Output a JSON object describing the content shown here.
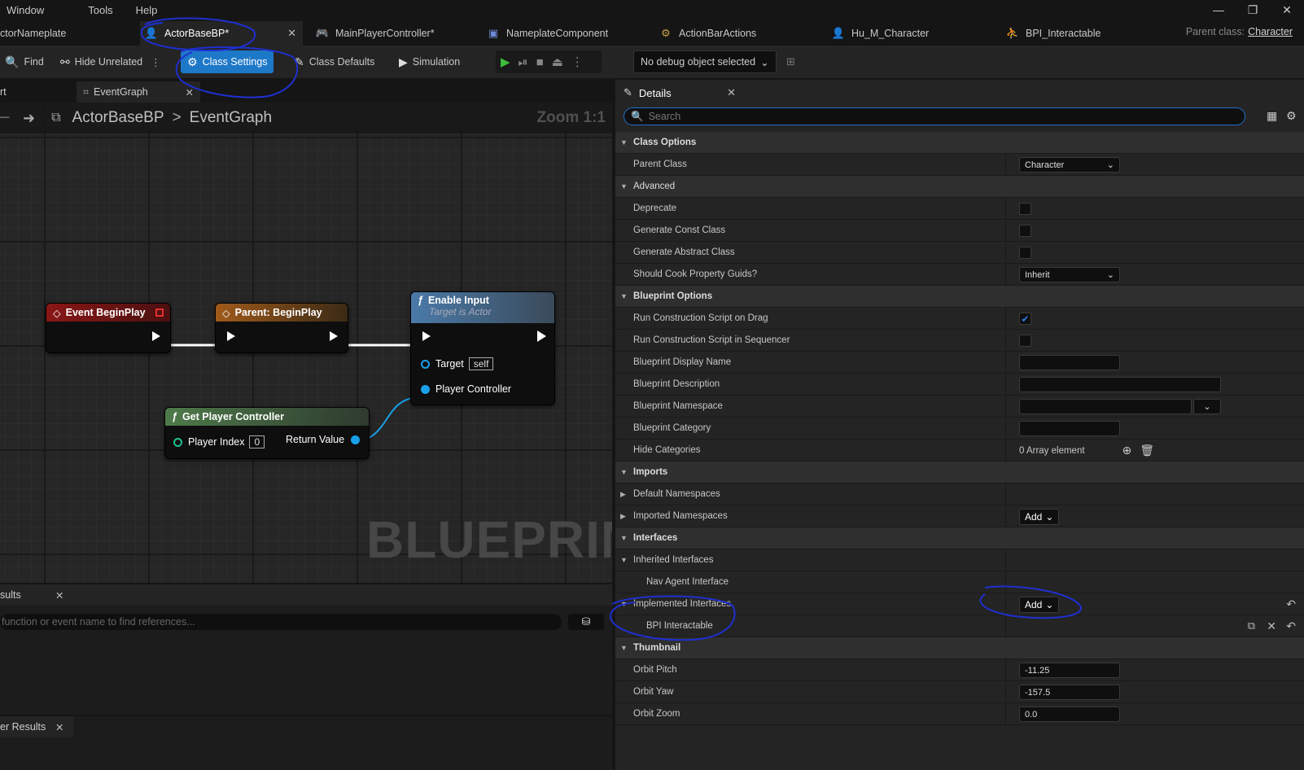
{
  "menu": {
    "items": [
      "Window",
      "Tools",
      "Help"
    ]
  },
  "window_controls": {
    "minimize": "—",
    "restore": "❐",
    "close": "✕"
  },
  "tabs": [
    {
      "label": "ctorNameplate"
    },
    {
      "label": "ActorBaseBP*"
    },
    {
      "label": "MainPlayerController*"
    },
    {
      "label": "NameplateComponent"
    },
    {
      "label": "ActionBarActions"
    },
    {
      "label": "Hu_M_Character"
    },
    {
      "label": "BPI_Interactable"
    }
  ],
  "parent_class": {
    "label": "Parent class:",
    "value": "Character"
  },
  "toolbar": {
    "find": "Find",
    "hide_unrelated": "Hide Unrelated",
    "class_settings": "Class Settings",
    "class_defaults": "Class Defaults",
    "simulation": "Simulation",
    "debug_object": "No debug object selected"
  },
  "graph_tabs": {
    "left": "rt",
    "event_graph": "EventGraph"
  },
  "breadcrumb": {
    "root": "ActorBaseBP",
    "sep": ">",
    "current": "EventGraph"
  },
  "zoom": "Zoom 1:1",
  "watermark": "BLUEPRINT",
  "nodes": {
    "begin_play": {
      "title": "Event BeginPlay"
    },
    "parent_begin_play": {
      "title": "Parent: BeginPlay"
    },
    "enable_input": {
      "title": "Enable Input",
      "subtitle": "Target is Actor",
      "pin_target": "Target",
      "pin_target_value": "self",
      "pin_pc": "Player Controller"
    },
    "get_pc": {
      "title": "Get Player Controller",
      "pin_index": "Player Index",
      "pin_index_value": "0",
      "pin_return": "Return Value"
    }
  },
  "results": {
    "tab1": "sults",
    "search_placeholder": "function or event name to find references...",
    "tab2": "er Results"
  },
  "details": {
    "tab": "Details",
    "search_placeholder": "Search",
    "rows": {
      "class_options": "Class Options",
      "parent_class": "Parent Class",
      "parent_class_value": "Character",
      "advanced": "Advanced",
      "deprecate": "Deprecate",
      "gen_const": "Generate Const Class",
      "gen_abstract": "Generate Abstract Class",
      "cook_guids": "Should Cook Property Guids?",
      "cook_guids_value": "Inherit",
      "bp_options": "Blueprint Options",
      "run_cs_drag": "Run Construction Script on Drag",
      "run_cs_seq": "Run Construction Script in Sequencer",
      "bp_display_name": "Blueprint Display Name",
      "bp_description": "Blueprint Description",
      "bp_namespace": "Blueprint Namespace",
      "bp_category": "Blueprint Category",
      "hide_categories": "Hide Categories",
      "hide_categories_value": "0 Array element",
      "imports": "Imports",
      "default_ns": "Default Namespaces",
      "imported_ns": "Imported Namespaces",
      "add": "Add",
      "interfaces": "Interfaces",
      "inherited_if": "Inherited Interfaces",
      "nav_agent": "Nav Agent Interface",
      "implemented_if": "Implemented Interfaces",
      "bpi_interactable": "BPI Interactable",
      "thumbnail": "Thumbnail",
      "orbit_pitch": "Orbit Pitch",
      "orbit_pitch_value": "-11.25",
      "orbit_yaw": "Orbit Yaw",
      "orbit_yaw_value": "-157.5",
      "orbit_zoom": "Orbit Zoom",
      "orbit_zoom_value": "0.0"
    }
  }
}
